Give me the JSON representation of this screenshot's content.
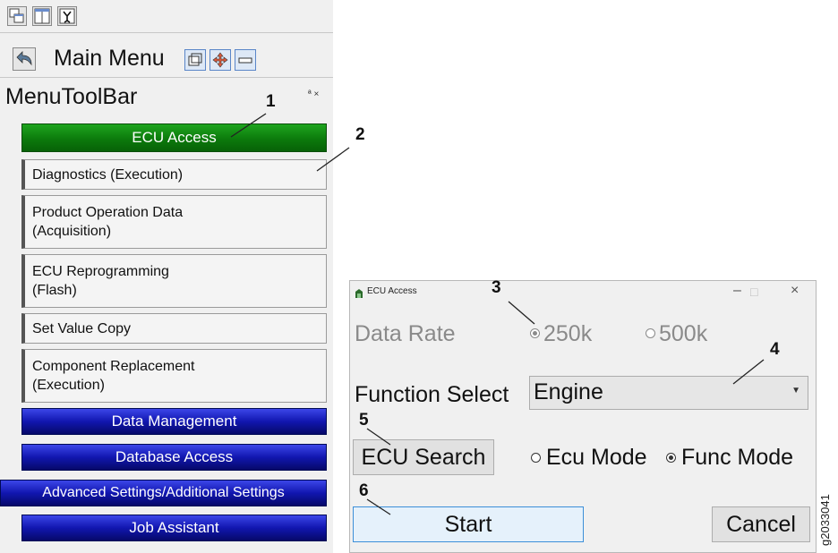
{
  "main_menu": {
    "title": "Main Menu"
  },
  "menu_toolbar": {
    "title": "MenuToolBar",
    "window_controls": "ª ×",
    "items": [
      {
        "label": "ECU Access",
        "style": "green"
      },
      {
        "label": "Diagnostics (Execution)",
        "style": "grey"
      },
      {
        "label": "Product Operation Data\n(Acquisition)",
        "style": "grey"
      },
      {
        "label": "ECU Reprogramming\n(Flash)",
        "style": "grey"
      },
      {
        "label": "Set Value Copy",
        "style": "grey"
      },
      {
        "label": "Component Replacement\n(Execution)",
        "style": "grey"
      },
      {
        "label": "Data Management",
        "style": "blue"
      },
      {
        "label": "Database Access",
        "style": "blue"
      },
      {
        "label": "Advanced Settings/Additional Settings",
        "style": "blue"
      },
      {
        "label": "Job Assistant",
        "style": "blue"
      }
    ]
  },
  "dialog": {
    "title": "ECU Access",
    "minimize": "–",
    "maximize": "□",
    "close": "×",
    "data_rate_label": "Data Rate",
    "data_rate_options": [
      "250k",
      "500k"
    ],
    "data_rate_selected": "250k",
    "function_select_label": "Function Select",
    "function_select_value": "Engine",
    "ecu_search_label": "ECU Search",
    "mode_options": [
      "Ecu Mode",
      "Func Mode"
    ],
    "mode_selected": "Func Mode",
    "start_label": "Start",
    "cancel_label": "Cancel"
  },
  "callouts": [
    "1",
    "2",
    "3",
    "4",
    "5",
    "6"
  ],
  "figure_code": "g2033041",
  "colors": {
    "green_button": "#0c7a0c",
    "blue_button": "#1116b0",
    "start_border": "#3c8fd8"
  }
}
